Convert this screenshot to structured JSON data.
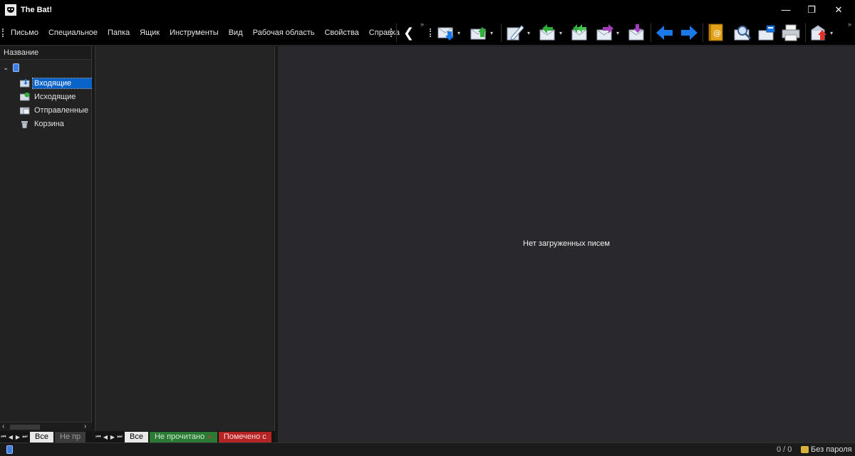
{
  "window": {
    "title": "The Bat!",
    "minimize_glyph": "—",
    "maximize_glyph": "❐",
    "close_glyph": "✕"
  },
  "menu": {
    "items": [
      "Письмо",
      "Специальное",
      "Папка",
      "Ящик",
      "Инструменты",
      "Вид",
      "Рабочая область",
      "Свойства",
      "Справка"
    ]
  },
  "toolbar": {
    "more_glyph": "»",
    "back_glyph": "❮",
    "icons": [
      "get-mail-icon",
      "send-mail-icon",
      "new-message-icon",
      "reply-icon",
      "reply-all-icon",
      "forward-icon",
      "redirect-icon",
      "previous-icon",
      "next-icon",
      "address-book-icon",
      "find-icon",
      "filters-icon",
      "print-icon",
      "backup-icon"
    ],
    "colors": {
      "arrow_blue": "#1a78e8",
      "arrow_green": "#2fae3a",
      "arrow_purple": "#a13fb8",
      "address_book": "#e3a21a"
    }
  },
  "folders": {
    "header": "Название",
    "expand_glyph": "⌄",
    "items": [
      {
        "label": "Входящие",
        "icon": "inbox-folder-icon",
        "selected": true
      },
      {
        "label": "Исходящие",
        "icon": "outbox-folder-icon",
        "selected": false
      },
      {
        "label": "Отправленные",
        "icon": "sent-folder-icon",
        "selected": false
      },
      {
        "label": "Корзина",
        "icon": "trash-icon",
        "selected": false
      }
    ],
    "scroll_left": "‹",
    "scroll_right": "›"
  },
  "folder_tabs": {
    "all": "Все",
    "unread_clipped": "Не пр"
  },
  "list_tabs": {
    "all": "Все",
    "unread": "Не прочитано",
    "marked_clipped": "Помечено с",
    "close_glyph": "✕"
  },
  "nav_arrows": [
    "⏮",
    "◀",
    "▶",
    "⏭"
  ],
  "viewer": {
    "empty_text": "Нет загруженных писем"
  },
  "status": {
    "count": "0 / 0",
    "password": "Без пароля"
  }
}
